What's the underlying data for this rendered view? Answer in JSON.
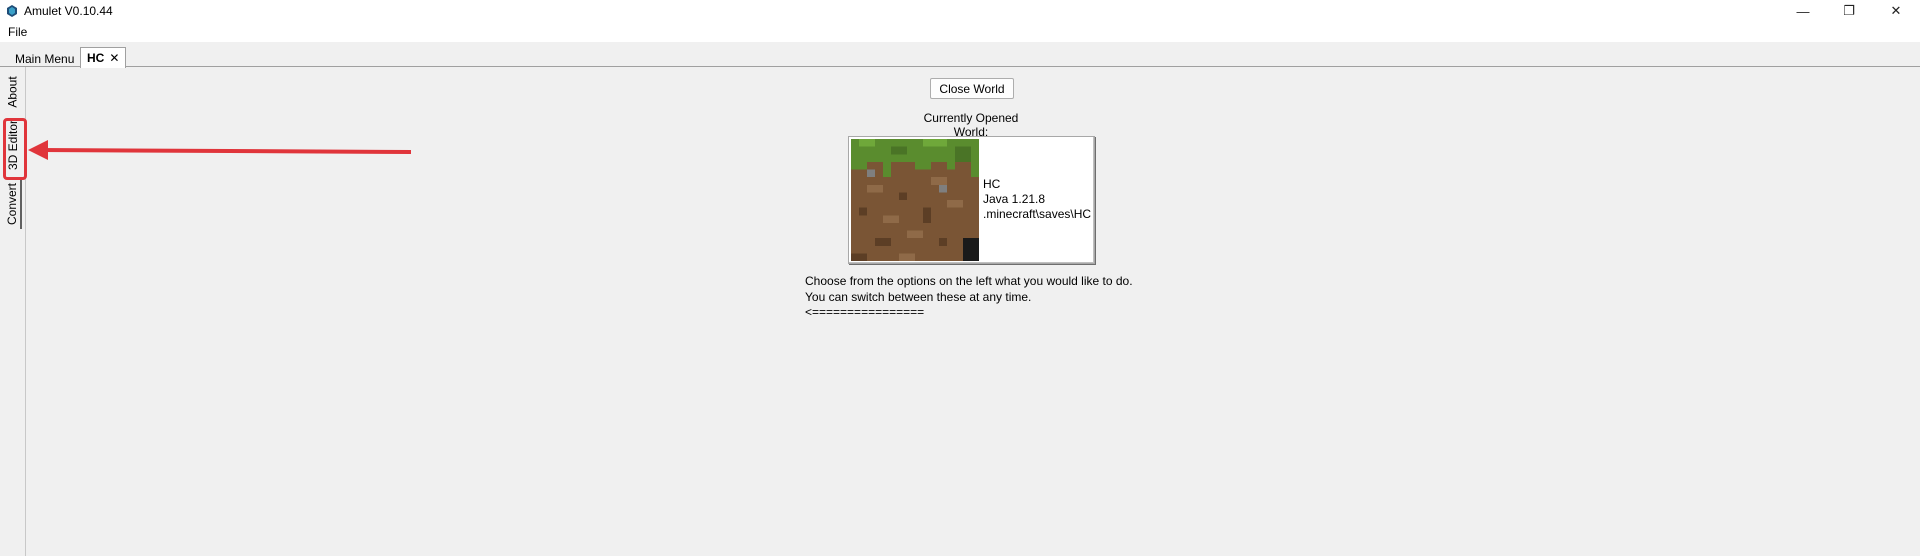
{
  "window": {
    "title": "Amulet V0.10.44",
    "minimize_glyph": "—",
    "maximize_glyph": "❐",
    "close_glyph": "✕",
    "icon": "amulet-logo-icon"
  },
  "menu": {
    "file_label": "File"
  },
  "tabs": [
    {
      "label": "Main Menu"
    },
    {
      "label": "HC",
      "close_glyph": "✕"
    }
  ],
  "side_tabs": [
    {
      "label": "About"
    },
    {
      "label": "3D Editor"
    },
    {
      "label": "Convert"
    }
  ],
  "main": {
    "close_world_label": "Close World",
    "currently_opened_label": "Currently Opened World:",
    "world": {
      "name": "HC",
      "version": "Java 1.21.8",
      "path": ".minecraft\\saves\\HC"
    },
    "instructions": [
      "Choose from the options on the left what you would like to do.",
      "You can switch between these at any time.",
      "<================"
    ]
  },
  "annotation": {
    "highlight_color": "#e0353b",
    "arrow_color": "#e0353b"
  }
}
